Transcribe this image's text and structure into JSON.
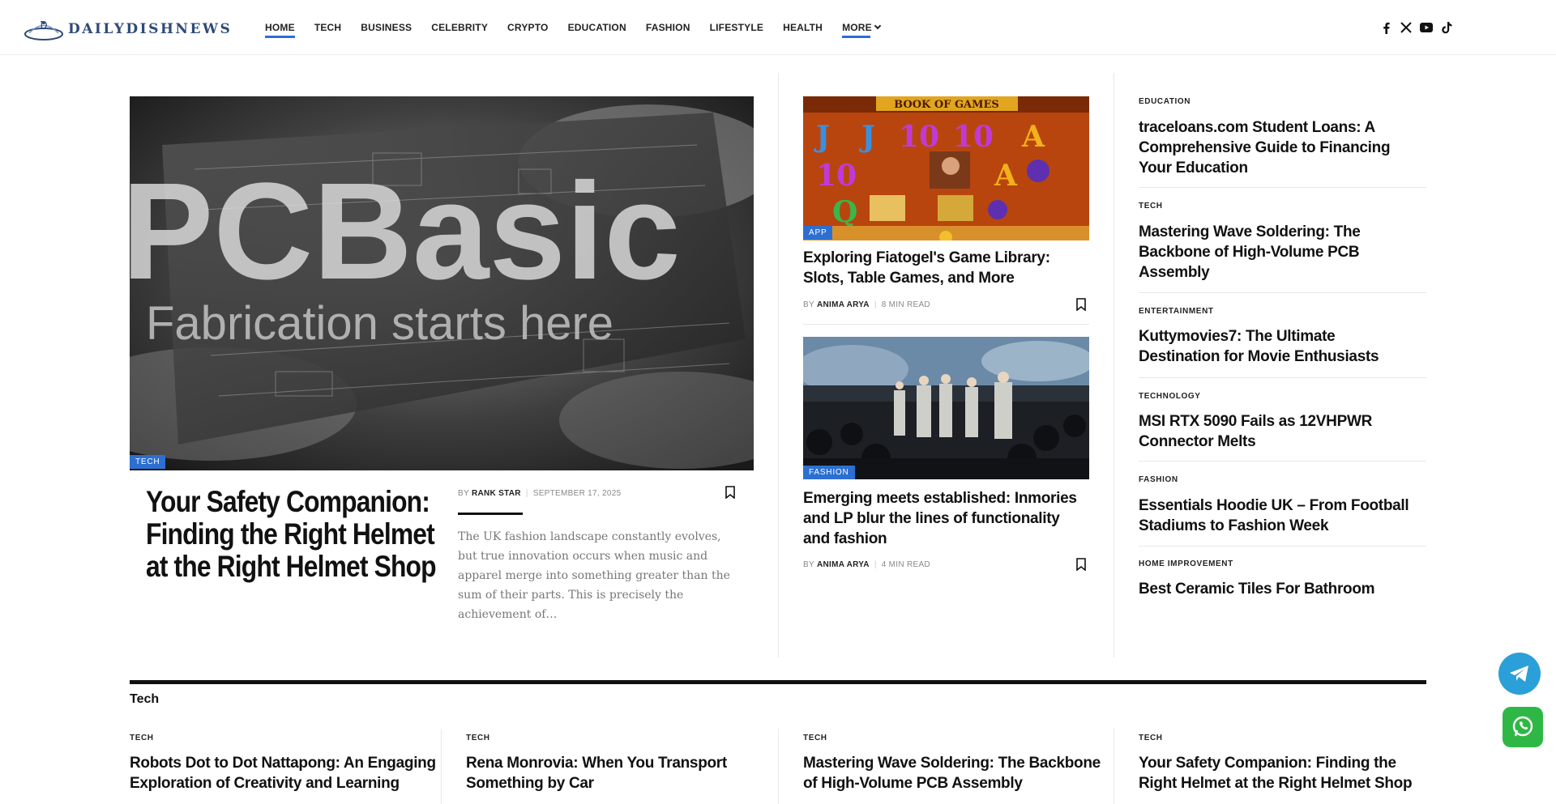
{
  "site": {
    "name": "DAILYDISHNEWS",
    "logo_letter": "D"
  },
  "nav": {
    "items": [
      "HOME",
      "TECH",
      "BUSINESS",
      "CELEBRITY",
      "CRYPTO",
      "EDUCATION",
      "FASHION",
      "LIFESTYLE",
      "HEALTH"
    ],
    "more_label": "MORE"
  },
  "socials": [
    "facebook-icon",
    "x-icon",
    "youtube-icon",
    "tiktok-icon"
  ],
  "feature": {
    "tag": "TECH",
    "image_text_1": "PCBasic",
    "image_text_2": "Fabrication starts here",
    "title": "Your Safety Companion: Finding the Right Helmet at the Right Helmet Shop",
    "by": "BY",
    "author": "RANK STAR",
    "date": "SEPTEMBER 17, 2025",
    "excerpt": "The UK fashion landscape constantly evolves, but true innovation occurs when music and apparel merge into something greater than the sum of their parts. This is precisely the achievement of…"
  },
  "middle": [
    {
      "tag": "APP",
      "image_text": "BOOK OF GAMES",
      "title": "Exploring Fiatogel's Game Library: Slots, Table Games, and More",
      "by": "BY",
      "author": "ANIMA ARYA",
      "read": "8 MIN READ"
    },
    {
      "tag": "FASHION",
      "title": "Emerging meets established: Inmories and LP blur the lines of functionality and fashion",
      "by": "BY",
      "author": "ANIMA ARYA",
      "read": "4 MIN READ"
    }
  ],
  "list": [
    {
      "category": "EDUCATION",
      "title": "traceloans.com Student Loans: A Comprehensive Guide to Financing Your Education"
    },
    {
      "category": "TECH",
      "title": "Mastering Wave Soldering: The Backbone of High-Volume PCB Assembly"
    },
    {
      "category": "ENTERTAINMENT",
      "title": "Kuttymovies7: The Ultimate Destination for Movie Enthusiasts"
    },
    {
      "category": "TECHNOLOGY",
      "title": "MSI RTX 5090 Fails as 12VHPWR Connector Melts"
    },
    {
      "category": "FASHION",
      "title": "Essentials Hoodie UK – From Football Stadiums to Fashion Week"
    },
    {
      "category": "HOME IMPROVEMENT",
      "title": "Best Ceramic Tiles For Bathroom"
    }
  ],
  "section": {
    "title": "Tech",
    "items": [
      {
        "category": "TECH",
        "title": "Robots Dot to Dot Nattapong: An Engaging Exploration of Creativity and Learning"
      },
      {
        "category": "TECH",
        "title": "Rena Monrovia: When You Transport Something by Car"
      },
      {
        "category": "TECH",
        "title": "Mastering Wave Soldering: The Backbone of High-Volume PCB Assembly"
      },
      {
        "category": "TECH",
        "title": "Your Safety Companion: Finding the Right Helmet at the Right Helmet Shop"
      }
    ]
  },
  "colors": {
    "accent": "#2c6fd1",
    "telegram": "#2a9fd8",
    "whatsapp": "#2fb745"
  }
}
